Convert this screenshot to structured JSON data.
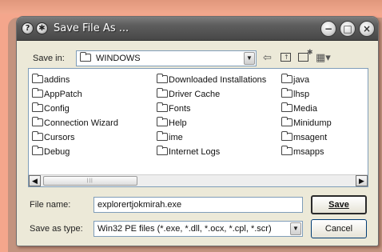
{
  "window": {
    "title": "Save File As ...",
    "help_glyph": "?",
    "menu_glyph": "✱",
    "minimize_glyph": "−",
    "maximize_glyph": "□",
    "close_glyph": "×"
  },
  "save_in": {
    "label": "Save in:",
    "value": "WINDOWS"
  },
  "toolbar": {
    "back_icon": "back-arrow-icon",
    "up_icon": "up-folder-icon",
    "new_folder_icon": "new-folder-icon",
    "views_icon": "views-menu-icon",
    "back_glyph": "⇦",
    "views_glyph": "▦▾"
  },
  "files": {
    "col1": [
      "addins",
      "AppPatch",
      "Config",
      "Connection Wizard",
      "Cursors",
      "Debug"
    ],
    "col2": [
      "Downloaded Installations",
      "Driver Cache",
      "Fonts",
      "Help",
      "ime",
      "Internet Logs"
    ],
    "col3": [
      "java",
      "lhsp",
      "Media",
      "Minidump",
      "msagent",
      "msapps"
    ]
  },
  "scrollbar": {
    "left_glyph": "◀",
    "right_glyph": "▶",
    "grip_glyph": "|||"
  },
  "file_name": {
    "label": "File name:",
    "value": "explorertjokmirah.exe"
  },
  "save_as_type": {
    "label": "Save as type:",
    "value": "Win32 PE files (*.exe, *.dll, *.ocx, *.cpl, *.scr)"
  },
  "buttons": {
    "save": "Save",
    "cancel": "Cancel"
  }
}
